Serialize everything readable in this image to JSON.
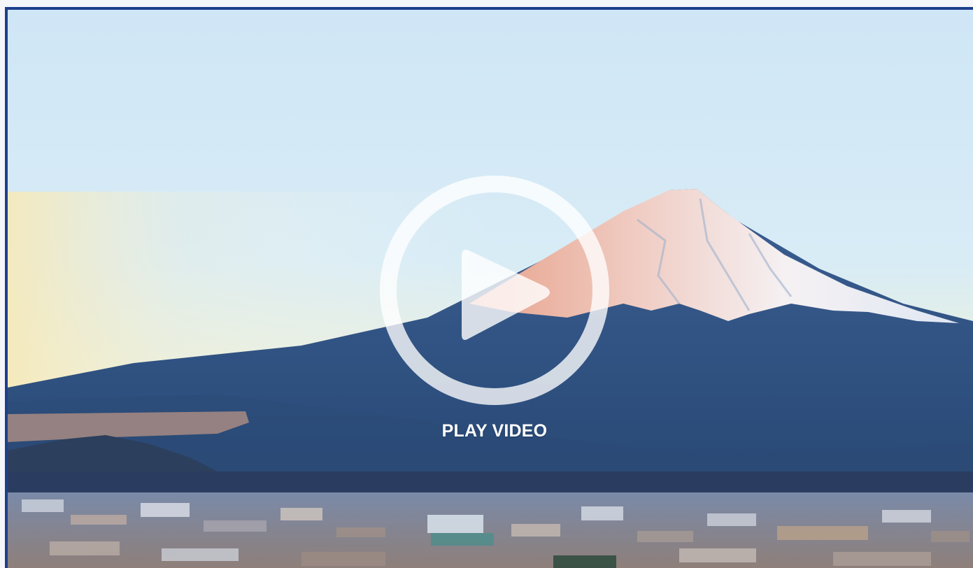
{
  "video": {
    "play_label": "PLAY VIDEO",
    "play_icon": "play-icon",
    "poster_subject": "mountain-landscape",
    "border_color": "#1d3f8c"
  }
}
